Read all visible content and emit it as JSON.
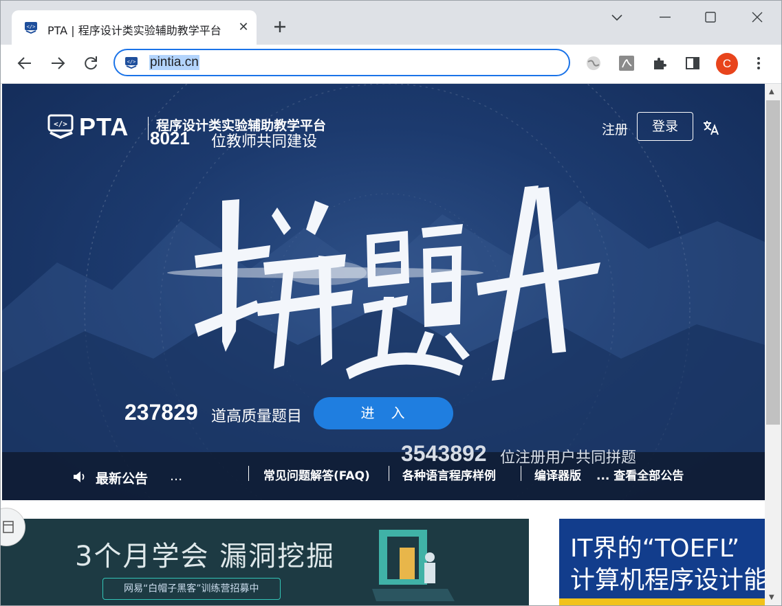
{
  "browser": {
    "tab": {
      "title": "PTA | 程序设计类实验辅助教学平台",
      "close_label": "✕"
    },
    "new_tab_label": "+",
    "address_bar": {
      "url": "pintia.cn"
    },
    "profile_initial": "C"
  },
  "header": {
    "brand": "PTA",
    "platform_name": "程序设计类实验辅助教学平台",
    "teacher_count": "8021",
    "teacher_label": "位教师共同建设",
    "register_label": "注册",
    "login_label": "登录"
  },
  "hero": {
    "question_count": "237829",
    "question_label": "道高质量题目",
    "enter_button": "进　入",
    "user_count": "3543892",
    "user_label": "位注册用户共同拼题"
  },
  "notice": {
    "title": "最新公告",
    "ellipsis": "...",
    "links": [
      "常见问题解答(FAQ)",
      "各种语言程序样例",
      "编译器版"
    ],
    "view_all": "... 查看全部公告"
  },
  "banners": {
    "left": {
      "title": "3个月学会 漏洞挖掘",
      "tag": "网易“白帽子黑客”训练营招募中"
    },
    "right": {
      "line1": "IT界的“TOEFL”",
      "line2": "计算机程序设计能"
    }
  },
  "colors": {
    "accent": "#1a73e8",
    "enter_button": "#1f7ee0",
    "hero_bg": "#1c3a6e",
    "avatar": "#e8441c"
  }
}
